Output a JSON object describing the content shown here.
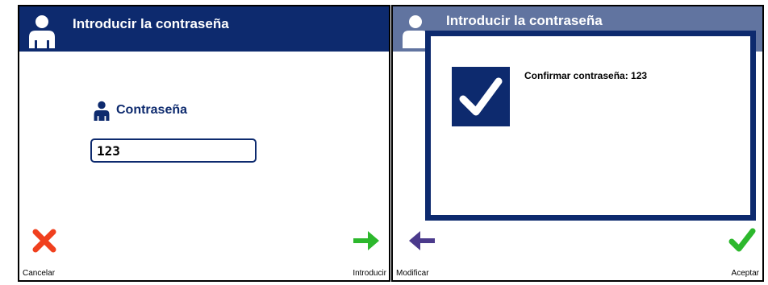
{
  "left_screen": {
    "header": {
      "title": "Introducir la contraseña",
      "icon": "user-icon"
    },
    "field": {
      "label": "Contraseña",
      "icon": "user-icon",
      "value": "123"
    },
    "buttons": {
      "cancel": {
        "label": "Cancelar",
        "icon": "close-icon",
        "color": "#f0401e"
      },
      "enter": {
        "label": "Introducir",
        "icon": "arrow-right-icon",
        "color": "#2db82d"
      }
    }
  },
  "right_screen": {
    "header": {
      "title": "Introducir la contraseña",
      "icon": "user-icon"
    },
    "dialog": {
      "message": "Confirmar contraseña: 123",
      "icon": "checkmark-icon"
    },
    "buttons": {
      "modify": {
        "label": "Modificar",
        "icon": "arrow-left-icon",
        "color": "#4b3a8c"
      },
      "accept": {
        "label": "Aceptar",
        "icon": "checkmark-icon",
        "color": "#2db82d"
      }
    }
  },
  "colors": {
    "primary": "#0d2a6e",
    "background": "#ffffff"
  }
}
